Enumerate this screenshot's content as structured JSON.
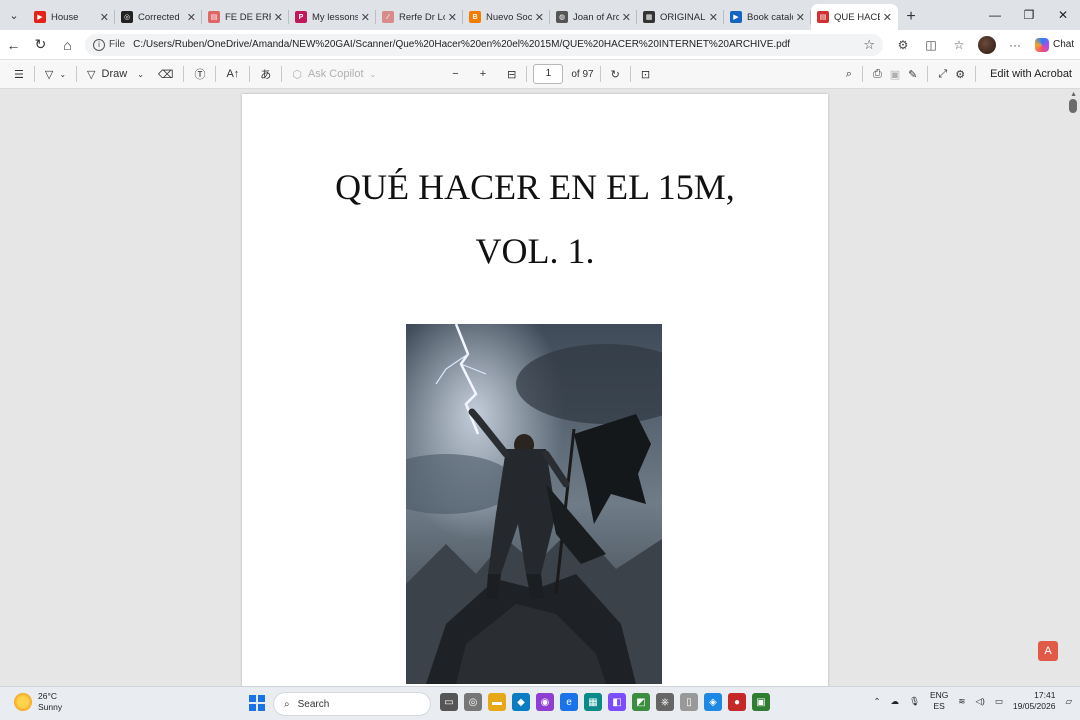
{
  "tabs": [
    {
      "title": "House",
      "fav_color": "#e62117",
      "fav_glyph": "▶"
    },
    {
      "title": "Corrected",
      "fav_color": "#222222",
      "fav_glyph": "◎"
    },
    {
      "title": "FE DE ERRA",
      "fav_color": "#e06666",
      "fav_glyph": "▤"
    },
    {
      "title": "My lessons",
      "fav_color": "#c2185b",
      "fav_glyph": "P"
    },
    {
      "title": "Rerfe Dr Loi",
      "fav_color": "#d98a8a",
      "fav_glyph": "∕"
    },
    {
      "title": "Nuevo Soci",
      "fav_color": "#f57c00",
      "fav_glyph": "B"
    },
    {
      "title": "Joan of Arc",
      "fav_color": "#555555",
      "fav_glyph": "◍"
    },
    {
      "title": "ORIGINALE",
      "fav_color": "#333333",
      "fav_glyph": "▦"
    },
    {
      "title": "Book catalo",
      "fav_color": "#1565c0",
      "fav_glyph": "▶"
    },
    {
      "title": "QUE HACE",
      "fav_color": "#d32f2f",
      "fav_glyph": "▤"
    }
  ],
  "address": {
    "scheme": "File",
    "url": "C:/Users/Ruben/OneDrive/Amanda/NEW%20GAI/Scanner/Que%20Hacer%20en%20el%2015M/QUE%20HACER%20INTERNET%20ARCHIVE.pdf"
  },
  "toolbar": {
    "draw_label": "Draw",
    "ask_copilot_label": "Ask Copilot",
    "page_current": "1",
    "page_total": "of 97",
    "edit_acrobat_label": "Edit with Acrobat"
  },
  "copilot": {
    "label": "Chat"
  },
  "document": {
    "title_line1": "QUÉ HACER EN EL 15M,",
    "title_line2": "VOL. 1."
  },
  "taskbar": {
    "temperature": "26°C",
    "weather": "Sunny",
    "search_placeholder": "Search",
    "lang_line1": "ENG",
    "lang_line2": "ES",
    "time": "17:41",
    "date": "19/05/2026"
  },
  "colors": {
    "accent": "#1a73e8",
    "acrobat": "#e05a47"
  }
}
